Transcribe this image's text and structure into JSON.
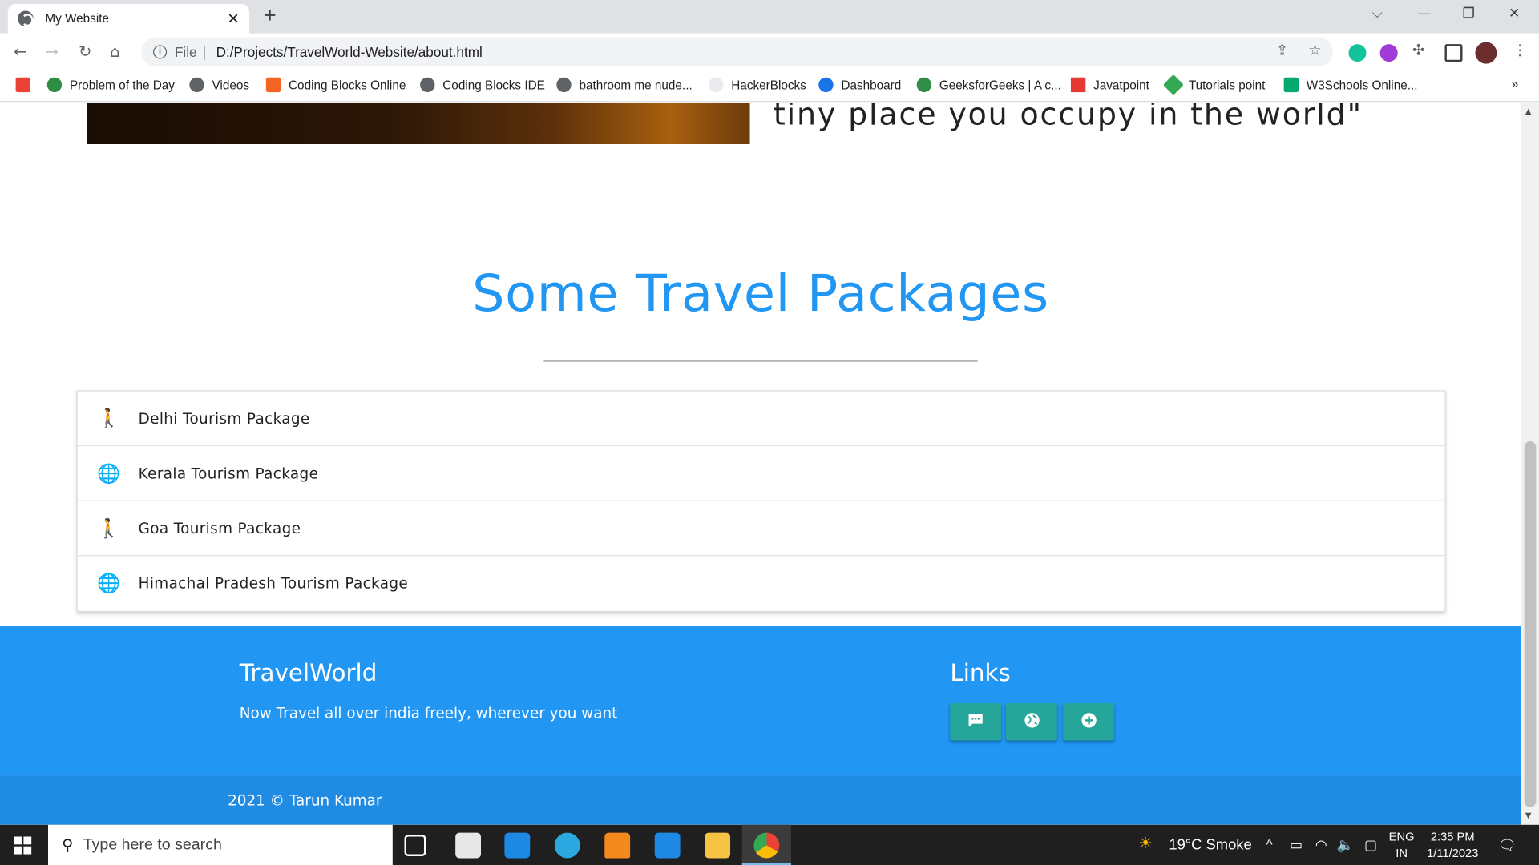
{
  "browser": {
    "tab_title": "My Website",
    "tab_close": "✕",
    "new_tab": "+",
    "window_controls": [
      "⌵",
      "—",
      "❐",
      "✕"
    ],
    "address": {
      "scheme": "File",
      "separator": "|",
      "url": "D:/Projects/TravelWorld-Website/about.html"
    },
    "nav": {
      "back": "←",
      "forward": "→",
      "reload": "↻",
      "home": "⌂"
    },
    "bookmarks": [
      {
        "label": "",
        "icon": "gmail-icon"
      },
      {
        "label": "Problem of the Day",
        "icon": "gfg-icon"
      },
      {
        "label": "Videos",
        "icon": "globe-icon"
      },
      {
        "label": "Coding Blocks Online",
        "icon": "codingblocks-icon"
      },
      {
        "label": "Coding Blocks IDE",
        "icon": "globe-icon"
      },
      {
        "label": "bathroom me nude...",
        "icon": "globe-icon"
      },
      {
        "label": "HackerBlocks",
        "icon": "hackerblocks-icon"
      },
      {
        "label": "Dashboard",
        "icon": "dashboard-icon"
      },
      {
        "label": "GeeksforGeeks | A c...",
        "icon": "gfg-icon"
      },
      {
        "label": "Javatpoint",
        "icon": "javatpoint-icon"
      },
      {
        "label": "Tutorials point",
        "icon": "tutorialspoint-icon"
      },
      {
        "label": "W3Schools Online...",
        "icon": "w3schools-icon"
      }
    ],
    "more_bookmarks": "»"
  },
  "page": {
    "quote_line": "tiny place you occupy in the world\"",
    "section_title": "Some Travel Packages",
    "packages": [
      {
        "label": "Delhi Tourism Package",
        "icon": "hiking-icon"
      },
      {
        "label": "Kerala Tourism Package",
        "icon": "travel-explore-icon"
      },
      {
        "label": "Goa Tourism Package",
        "icon": "hiking-icon"
      },
      {
        "label": "Himachal Pradesh Tourism Package",
        "icon": "travel-explore-icon"
      }
    ],
    "footer": {
      "brand": "TravelWorld",
      "tagline": "Now Travel all over india freely, wherever you want",
      "links_title": "Links",
      "link_buttons": [
        {
          "icon": "chat-icon",
          "glyph": "💬"
        },
        {
          "icon": "public-icon",
          "glyph": "◍"
        },
        {
          "icon": "add-circle-icon",
          "glyph": "⊕"
        }
      ],
      "copyright": "2021 © Tarun Kumar"
    },
    "colors": {
      "accent": "#2196f3",
      "button": "#26a69a",
      "copyright_bar": "#1f8be3"
    }
  },
  "taskbar": {
    "search_placeholder": "Type here to search",
    "weather": "19°C  Smoke",
    "lang_top": "ENG",
    "lang_bottom": "IN",
    "time": "2:35 PM",
    "date": "1/11/2023"
  }
}
